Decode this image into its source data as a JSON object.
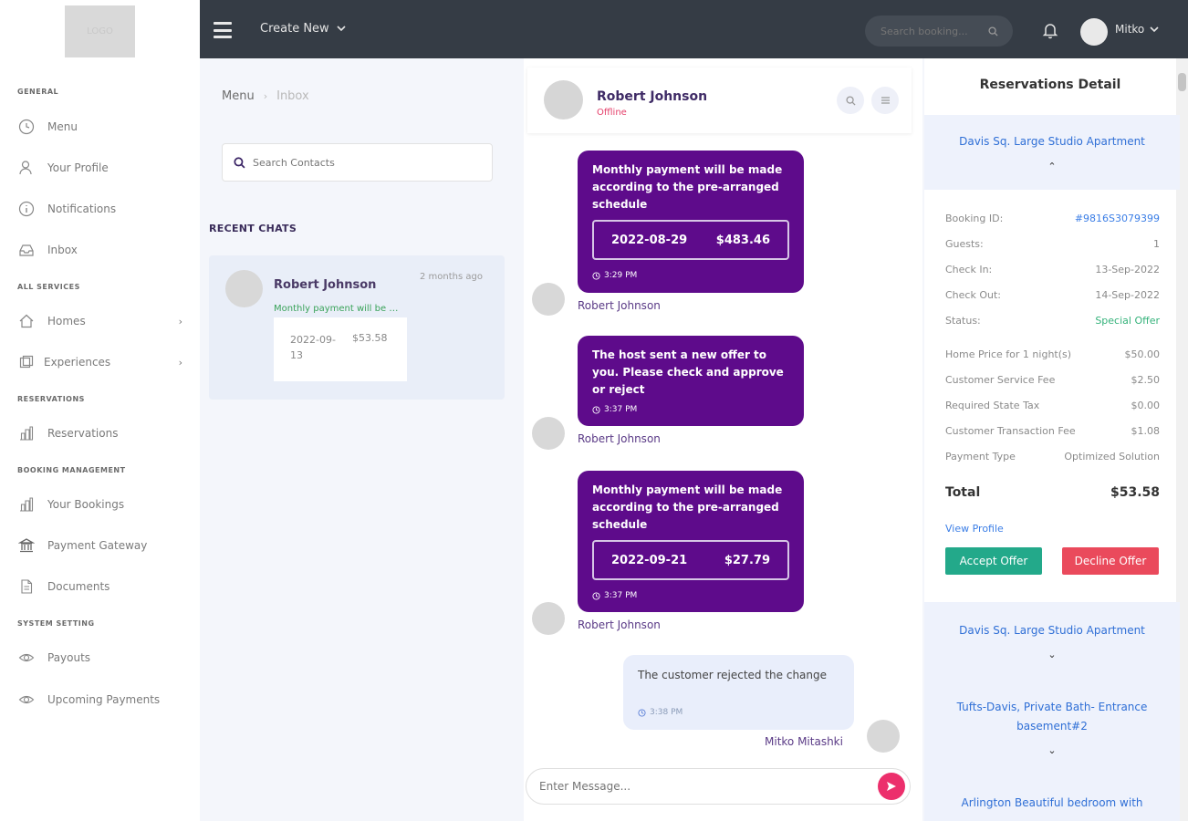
{
  "app": {
    "logo_text": "LOGO",
    "create_new": "Create New",
    "search_placeholder": "Search booking...",
    "user_name": "Mitko"
  },
  "sidebar": {
    "sections": {
      "general": "GENERAL",
      "all_services": "ALL SERVICES",
      "reservations": "RESERVATIONS",
      "booking_management": "BOOKING MANAGEMENT",
      "system_setting": "SYSTEM SETTING"
    },
    "items": {
      "menu": "Menu",
      "profile": "Your Profile",
      "notifications": "Notifications",
      "inbox": "Inbox",
      "homes": "Homes",
      "experiences": "Experiences",
      "reservations": "Reservations",
      "bookings": "Your Bookings",
      "payment_gateway": "Payment Gateway",
      "documents": "Documents",
      "payouts": "Payouts",
      "upcoming": "Upcoming Payments"
    }
  },
  "contacts": {
    "breadcrumb": [
      "Menu",
      "Inbox"
    ],
    "search_placeholder": "Search Contacts",
    "recent_title": "RECENT CHATS",
    "chat": {
      "name": "Robert Johnson",
      "time": "2 months ago",
      "preview": "Monthly payment will be made according to the pre-arranged schedule",
      "offer_date": "2022-09-13",
      "offer_date_line1": "2022-09-",
      "offer_date_line2": "13",
      "offer_amount": "$53.58"
    }
  },
  "conversation": {
    "contact_name": "Robert Johnson",
    "contact_status": "Offline",
    "messages": [
      {
        "text": "Monthly payment will be made according to the pre-arranged schedule",
        "offer_date": "2022-08-29",
        "offer_amount": "$483.46",
        "time": "3:29 PM",
        "sender": "Robert Johnson"
      },
      {
        "text": "The host sent a new offer to you. Please check and approve or reject",
        "time": "3:37 PM",
        "sender": "Robert Johnson"
      },
      {
        "text": "Monthly payment will be made according to the pre-arranged schedule",
        "offer_date": "2022-09-21",
        "offer_amount": "$27.79",
        "time": "3:37 PM",
        "sender": "Robert Johnson"
      },
      {
        "text": "The customer rejected the change",
        "time": "3:38 PM",
        "sender": "Mitko Mitashki"
      }
    ],
    "composer_placeholder": "Enter Message..."
  },
  "details": {
    "title": "Reservations Detail",
    "apartment_1": "Davis Sq. Large Studio Apartment",
    "rows": [
      {
        "label": "Booking ID:",
        "value": "#9816S3079399"
      },
      {
        "label": "Guests:",
        "value": "1"
      },
      {
        "label": "Check In:",
        "value": "13-Sep-2022"
      },
      {
        "label": "Check Out:",
        "value": "14-Sep-2022"
      },
      {
        "label": "Status:",
        "value": "Special Offer"
      },
      {
        "label": "Home Price for 1 night(s)",
        "value": "$50.00"
      },
      {
        "label": "Customer Service Fee",
        "value": "$2.50"
      },
      {
        "label": "Required State Tax",
        "value": "$0.00"
      },
      {
        "label": "Customer Transaction Fee",
        "value": "$1.08"
      },
      {
        "label": "Payment Type",
        "value": "Optimized Solution"
      }
    ],
    "total_label": "Total",
    "total_value": "$53.58",
    "view_profile": "View Profile",
    "accept": "Accept Offer",
    "decline": "Decline Offer",
    "apartment_2": "Davis Sq. Large Studio Apartment",
    "apartment_3": "Tufts-Davis, Private Bath- Entrance basement#2",
    "apartment_4": "Arlington Beautiful bedroom with"
  }
}
